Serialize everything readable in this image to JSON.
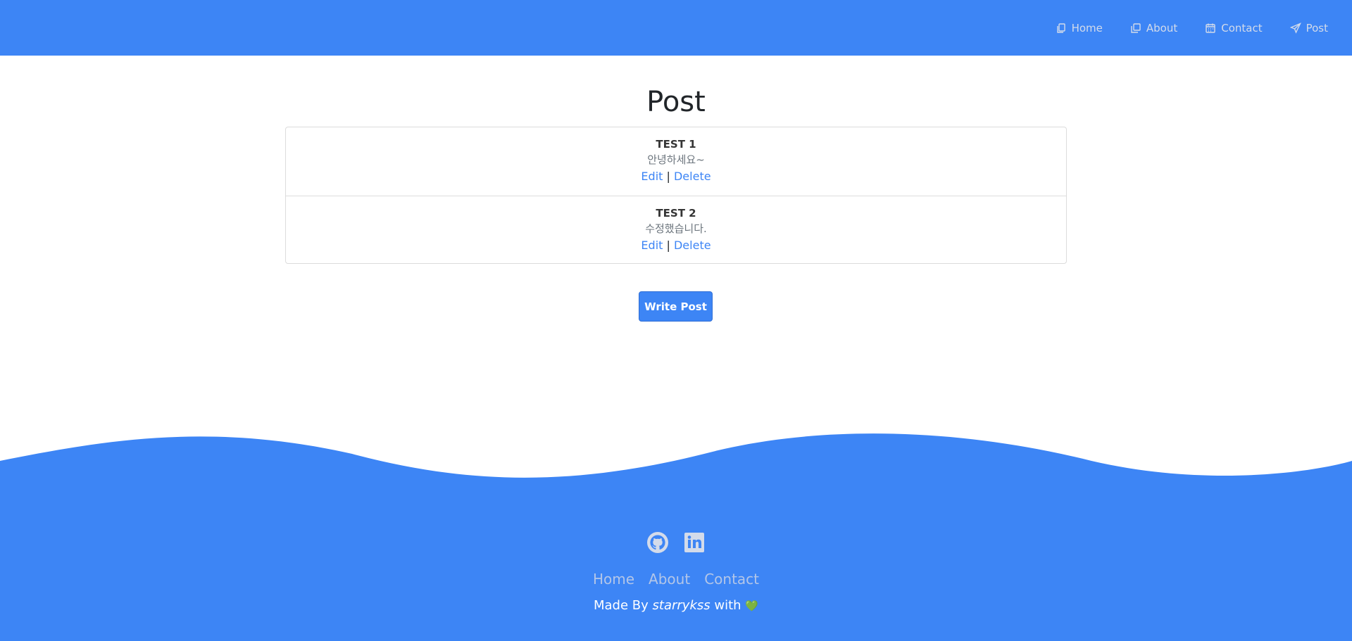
{
  "nav": {
    "items": [
      {
        "label": "Home",
        "icon": "copy-icon"
      },
      {
        "label": "About",
        "icon": "square-stack-icon"
      },
      {
        "label": "Contact",
        "icon": "calendar-icon"
      },
      {
        "label": "Post",
        "icon": "paper-plane-icon"
      }
    ]
  },
  "page": {
    "title": "Post"
  },
  "posts": [
    {
      "title": "TEST 1",
      "body": "안녕하세요~",
      "edit": "Edit",
      "sep": "|",
      "delete": "Delete"
    },
    {
      "title": "TEST 2",
      "body": "수정했습니다.",
      "edit": "Edit",
      "sep": "|",
      "delete": "Delete"
    }
  ],
  "write_button": "Write Post",
  "footer": {
    "icons": [
      "github-icon",
      "linkedin-icon"
    ],
    "links": [
      "Home",
      "About",
      "Contact"
    ],
    "credit_prefix": "Made By",
    "credit_name": "starrykss",
    "credit_suffix": "with",
    "heart": "💚"
  },
  "colors": {
    "primary": "#3d85f5",
    "nav_text": "#d3dbea",
    "footer_link": "#b3c6e8",
    "heart": "#2fd36a"
  }
}
